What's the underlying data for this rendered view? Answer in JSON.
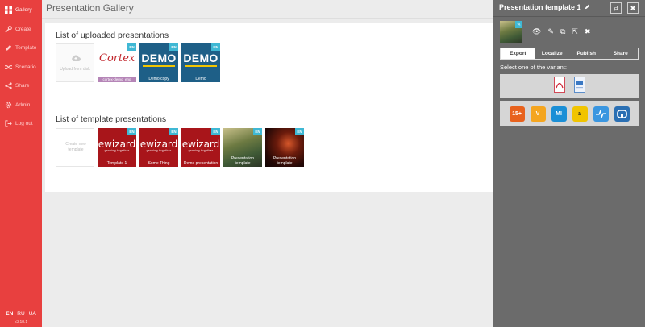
{
  "sidebar": {
    "items": [
      {
        "label": "Gallery",
        "icon": "grid-icon"
      },
      {
        "label": "Create",
        "icon": "wrench-icon"
      },
      {
        "label": "Template",
        "icon": "pencil-icon"
      },
      {
        "label": "Scenario",
        "icon": "shuffle-icon"
      },
      {
        "label": "Share",
        "icon": "share-icon"
      },
      {
        "label": "Admin",
        "icon": "gear-icon"
      },
      {
        "label": "Log out",
        "icon": "logout-icon"
      }
    ],
    "languages": [
      "EN",
      "RU",
      "UA"
    ],
    "version": "v3.18.1"
  },
  "main": {
    "title": "Presentation Gallery",
    "uploaded": {
      "title": "List of uploaded presentations",
      "upload_label": "Upload from disk",
      "items": [
        {
          "caption": "cortex-demo_eng",
          "badge": "EN",
          "logo": "Cortex"
        },
        {
          "caption": "Demo copy",
          "badge": "EN",
          "word": "DEMO"
        },
        {
          "caption": "Demo",
          "badge": "EN",
          "word": "DEMO"
        }
      ]
    },
    "templates": {
      "title": "List of template presentations",
      "create_label": "Create new template",
      "items": [
        {
          "caption": "Template 1",
          "badge": "EN",
          "logo": "ewizard",
          "tagline": "growing together"
        },
        {
          "caption": "Some Thing",
          "badge": "EN",
          "logo": "ewizard",
          "tagline": "growing together"
        },
        {
          "caption": "Demo presentation",
          "badge": "EN",
          "logo": "ewizard",
          "tagline": "growing together"
        },
        {
          "caption": "Presentation template",
          "badge": "EN"
        },
        {
          "caption": "Presentation template",
          "badge": "EN"
        }
      ]
    }
  },
  "panel": {
    "title": "Presentation template 1",
    "tabs": [
      "Export",
      "Localize",
      "Publish",
      "Share"
    ],
    "active_tab": "Export",
    "select_label": "Select one of the variant:",
    "apps": [
      {
        "icon": "tiles-app-icon",
        "color": "#e8621d",
        "text": "15+"
      },
      {
        "icon": "veeva-app-icon",
        "color": "#f4a51f",
        "text": "V"
      },
      {
        "icon": "mi-app-icon",
        "color": "#1b8fd6",
        "text": "MI"
      },
      {
        "icon": "yellow-app-icon",
        "color": "#f1c400",
        "text": "a"
      },
      {
        "icon": "pulse-app-icon",
        "color": "#3a96e0",
        "text": ""
      },
      {
        "icon": "abbott-app-icon",
        "color": "#2a6fb3",
        "text": ""
      }
    ]
  }
}
